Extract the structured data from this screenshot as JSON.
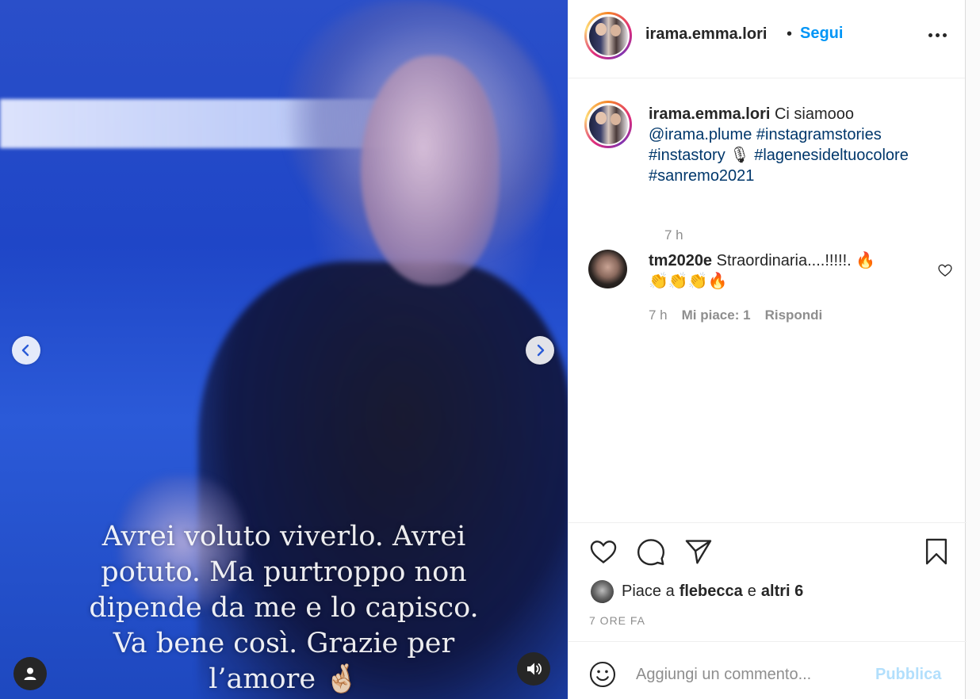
{
  "post": {
    "media": {
      "overlay_lines": [
        "Avrei voluto viverlo. Avrei",
        "potuto. Ma purtroppo non",
        "dipende da me e lo capisco.",
        "Va bene così. Grazie per",
        "l’amore 🤞🏻"
      ],
      "prev_icon": "chevron-left-icon",
      "next_icon": "chevron-right-icon",
      "tags_icon": "user-icon",
      "audio_icon": "speaker-icon"
    },
    "header": {
      "username": "irama.emma.lori",
      "separator": "•",
      "follow_label": "Segui",
      "more_icon": "more-icon"
    },
    "caption": {
      "username": "irama.emma.lori",
      "text": "Ci siamooo",
      "mention": "@irama.plume",
      "hashtags": [
        "#instagramstories",
        "#instastory",
        "#lagenesideltuocolore",
        "#sanremo2021"
      ],
      "emoji": "🎙",
      "time": "7 h"
    },
    "comments": [
      {
        "username": "tm2020e",
        "text": "Straordinaria....!!!!!. 🔥",
        "text_line2": "👏👏👏🔥",
        "time": "7 h",
        "likes_label": "Mi piace: 1",
        "reply_label": "Rispondi"
      }
    ],
    "likes": {
      "prefix": "Piace a",
      "user": "flebecca",
      "conjunction": "e",
      "others": "altri 6"
    },
    "date": "7 ORE FA",
    "add_comment": {
      "placeholder": "Aggiungi un commento...",
      "publish_label": "Pubblica"
    }
  },
  "colors": {
    "accent": "#0095f6",
    "link": "#00376b",
    "muted": "#8e8e8e",
    "publish_disabled": "#b2dffc"
  }
}
